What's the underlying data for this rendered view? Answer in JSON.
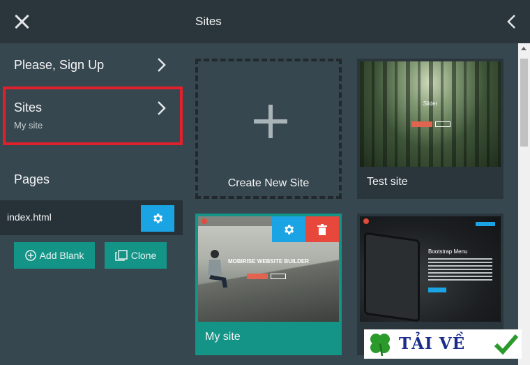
{
  "left": {
    "nav": [
      {
        "title": "Please, Sign Up"
      },
      {
        "title": "Sites",
        "subtitle": "My site"
      }
    ],
    "pages_label": "Pages",
    "pages": [
      {
        "name": "index.html"
      }
    ],
    "add_blank": "Add Blank",
    "clone": "Clone"
  },
  "right": {
    "title": "Sites",
    "cards": [
      {
        "label": "Create New Site"
      },
      {
        "label": "Test site",
        "thumb_heading": "Slider",
        "thumb_btn": "",
        "thumb_link": ""
      },
      {
        "label": "My site",
        "thumb_heading": "MOBIRISE WEBSITE BUILDER"
      },
      {
        "label": "",
        "thumb_heading": "Bootstrap Menu"
      }
    ]
  },
  "watermark": {
    "text": "TẢI VỀ"
  },
  "colors": {
    "accent_blue": "#1aa4e4",
    "teal": "#149487",
    "danger": "#e8473b",
    "highlight_border": "#e0202c"
  }
}
